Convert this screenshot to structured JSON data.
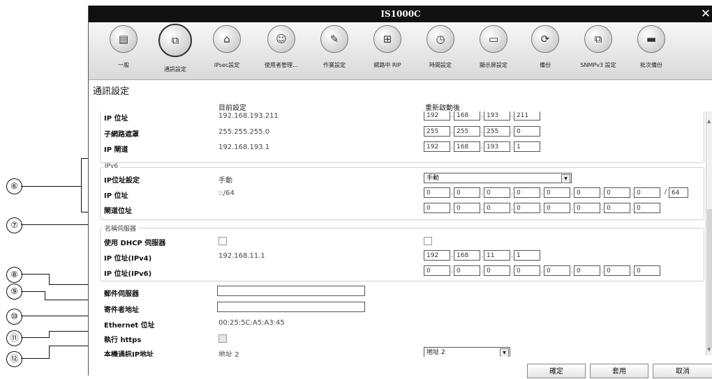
{
  "window": {
    "title": "IS1000C"
  },
  "toolbar": [
    {
      "label": "一般",
      "icon": "server-icon"
    },
    {
      "label": "通訊設定",
      "icon": "network-computers-icon"
    },
    {
      "label": "IPsec設定",
      "icon": "ipsec-lock-icon"
    },
    {
      "label": "使用者管理…",
      "icon": "users-icon"
    },
    {
      "label": "作業設定",
      "icon": "document-settings-icon"
    },
    {
      "label": "網路中 RIP",
      "icon": "rip-network-icon"
    },
    {
      "label": "時間設定",
      "icon": "clock-icon"
    },
    {
      "label": "顯示屏設定",
      "icon": "display-icon"
    },
    {
      "label": "備份",
      "icon": "backup-disk-icon"
    },
    {
      "label": "SNMPv3 設定",
      "icon": "snmp-computers-icon"
    },
    {
      "label": "批次備份",
      "icon": "batch-backup-drive-icon"
    }
  ],
  "page_title": "通訊設定",
  "columns": {
    "current": "目前設定",
    "after_restart": "重新啟動後"
  },
  "ipv4": {
    "ip_label": "IP 位址",
    "ip_value": "192.168.193.211",
    "ip_octets": [
      "192",
      "168",
      "193",
      "211"
    ],
    "mask_label": "子網路遮罩",
    "mask_value": "255.255.255.0",
    "mask_octets": [
      "255",
      "255",
      "255",
      "0"
    ],
    "gw_label": "IP 閘道",
    "gw_value": "192.168.193.1",
    "gw_octets": [
      "192",
      "168",
      "193",
      "1"
    ]
  },
  "ipv6": {
    "legend": "IPv6",
    "mode_label": "IP位址設定",
    "mode_value": "手動",
    "mode_select": "手動",
    "ip_label": "IP 位址",
    "ip_value": "::/64",
    "ip_fields": [
      "0",
      "0",
      "0",
      "0",
      "0",
      "0",
      "0",
      "0"
    ],
    "prefix": "64",
    "gw_label": "閘道位址",
    "gw_fields": [
      "0",
      "0",
      "0",
      "0",
      "0",
      "0",
      "0",
      "0"
    ]
  },
  "dns": {
    "legend": "名稱伺服器",
    "dhcp_label": "使用 DHCP 伺服器",
    "v4_label": "IP 位址(IPv4)",
    "v4_value": "192.168.11.1",
    "v4_octets": [
      "192",
      "168",
      "11",
      "1"
    ],
    "v6_label": "IP 位址(IPv6)",
    "v6_fields": [
      "0",
      "0",
      "0",
      "0",
      "0",
      "0",
      "0",
      "0"
    ]
  },
  "mail_server_label": "郵件伺服器",
  "sender_label": "寄件者地址",
  "ethernet_label": "Ethernet 位址",
  "ethernet_value": "00:25:5C:A5:A3:45",
  "https_label": "執行 https",
  "local_ip_label": "本機通訊IP地址",
  "local_ip_value": "地址 2",
  "local_ip_select": "地址 2",
  "buttons": {
    "ok": "確定",
    "apply": "套用",
    "cancel": "取消"
  },
  "callouts": [
    "⑥",
    "⑦",
    "⑧",
    "⑨",
    "⑩",
    "⑪",
    "⑫"
  ]
}
